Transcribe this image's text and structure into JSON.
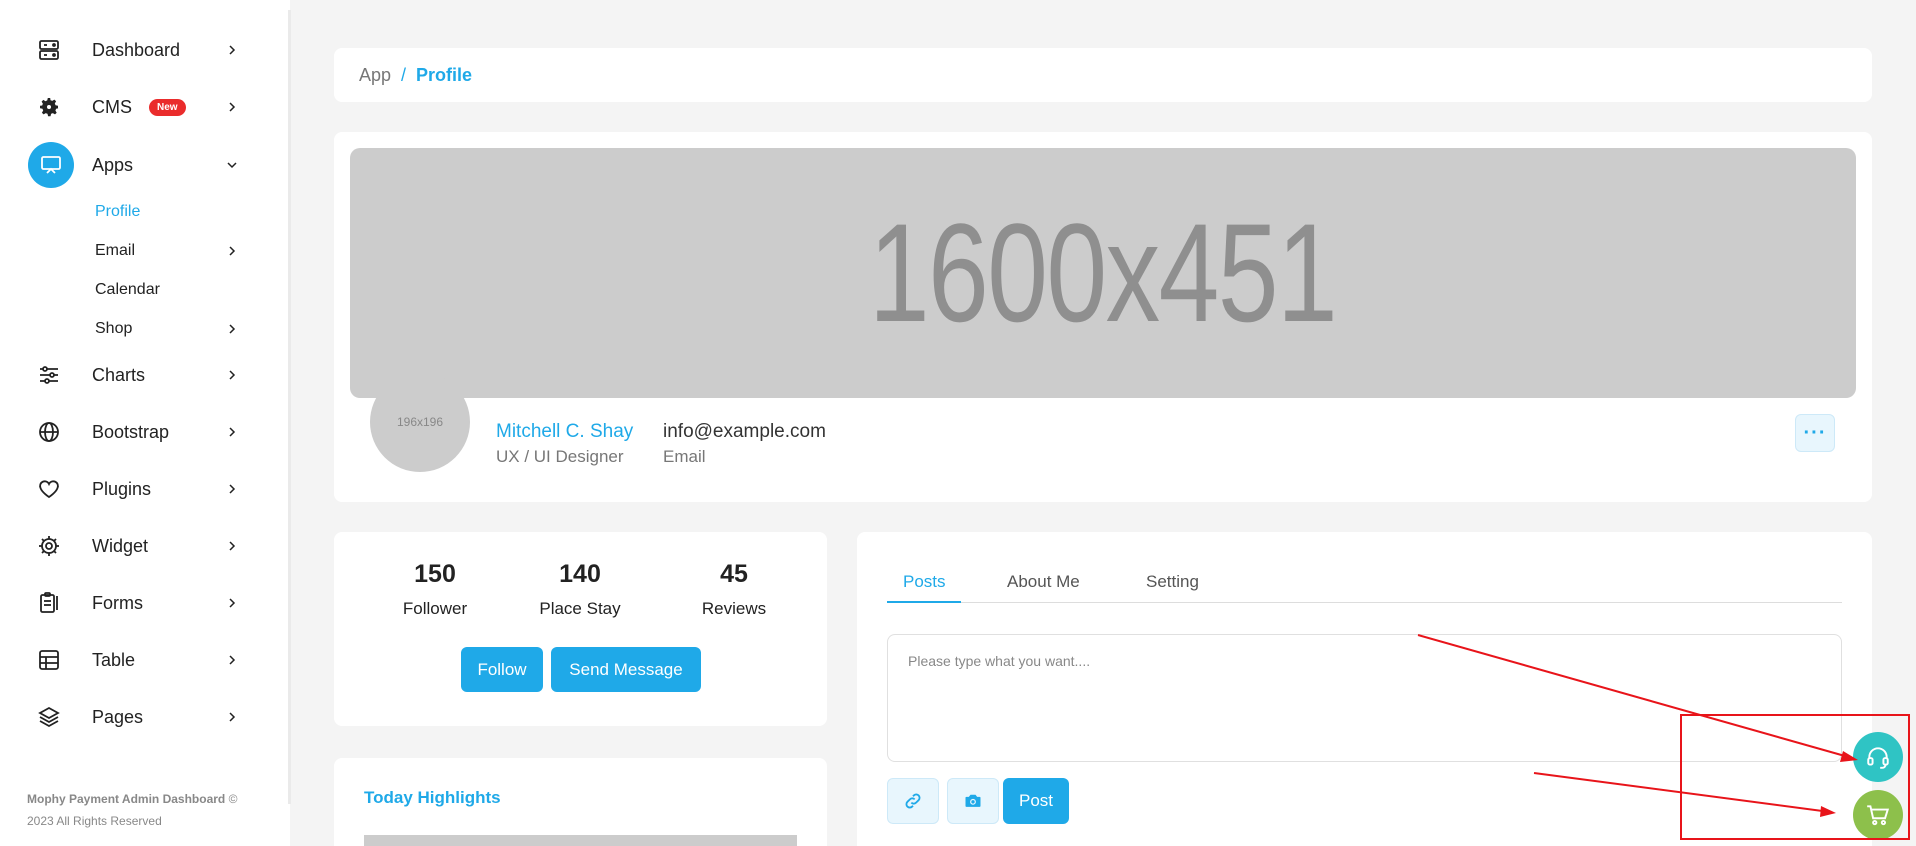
{
  "sidebar": {
    "items": [
      {
        "label": "Dashboard",
        "icon": "dashboard-icon"
      },
      {
        "label": "CMS",
        "icon": "gear-icon",
        "badge": "New"
      },
      {
        "label": "Apps",
        "icon": "monitor-icon",
        "expanded": true
      },
      {
        "label": "Charts",
        "icon": "sliders-icon"
      },
      {
        "label": "Bootstrap",
        "icon": "globe-icon"
      },
      {
        "label": "Plugins",
        "icon": "heart-icon"
      },
      {
        "label": "Widget",
        "icon": "cog-icon"
      },
      {
        "label": "Forms",
        "icon": "clipboard-icon"
      },
      {
        "label": "Table",
        "icon": "table-icon"
      },
      {
        "label": "Pages",
        "icon": "layers-icon"
      }
    ],
    "apps_subitems": [
      {
        "label": "Profile",
        "active": true
      },
      {
        "label": "Email"
      },
      {
        "label": "Calendar"
      },
      {
        "label": "Shop"
      }
    ],
    "footer_title": "Mophy Payment Admin Dashboard",
    "footer_copy": "©",
    "footer_rights": "2023 All Rights Reserved"
  },
  "breadcrumb": {
    "root": "App",
    "separator": "/",
    "current": "Profile"
  },
  "profile": {
    "cover_placeholder": "1600x451",
    "avatar_placeholder": "196x196",
    "name": "Mitchell C. Shay",
    "role": "UX / UI Designer",
    "email": "info@example.com",
    "email_label": "Email",
    "more_label": "···"
  },
  "stats": [
    {
      "value": "150",
      "label": "Follower"
    },
    {
      "value": "140",
      "label": "Place Stay"
    },
    {
      "value": "45",
      "label": "Reviews"
    }
  ],
  "actions": {
    "follow": "Follow",
    "send_message": "Send Message"
  },
  "highlights": {
    "title": "Today Highlights"
  },
  "posts": {
    "tabs": [
      "Posts",
      "About Me",
      "Setting"
    ],
    "active_tab": "Posts",
    "placeholder": "Please type what you want....",
    "post_button": "Post"
  },
  "colors": {
    "accent": "#1fa9e8",
    "badge": "#ea2c2c",
    "support": "#2fc4c4",
    "cart": "#8dc04b",
    "annotation": "#e8141a"
  }
}
